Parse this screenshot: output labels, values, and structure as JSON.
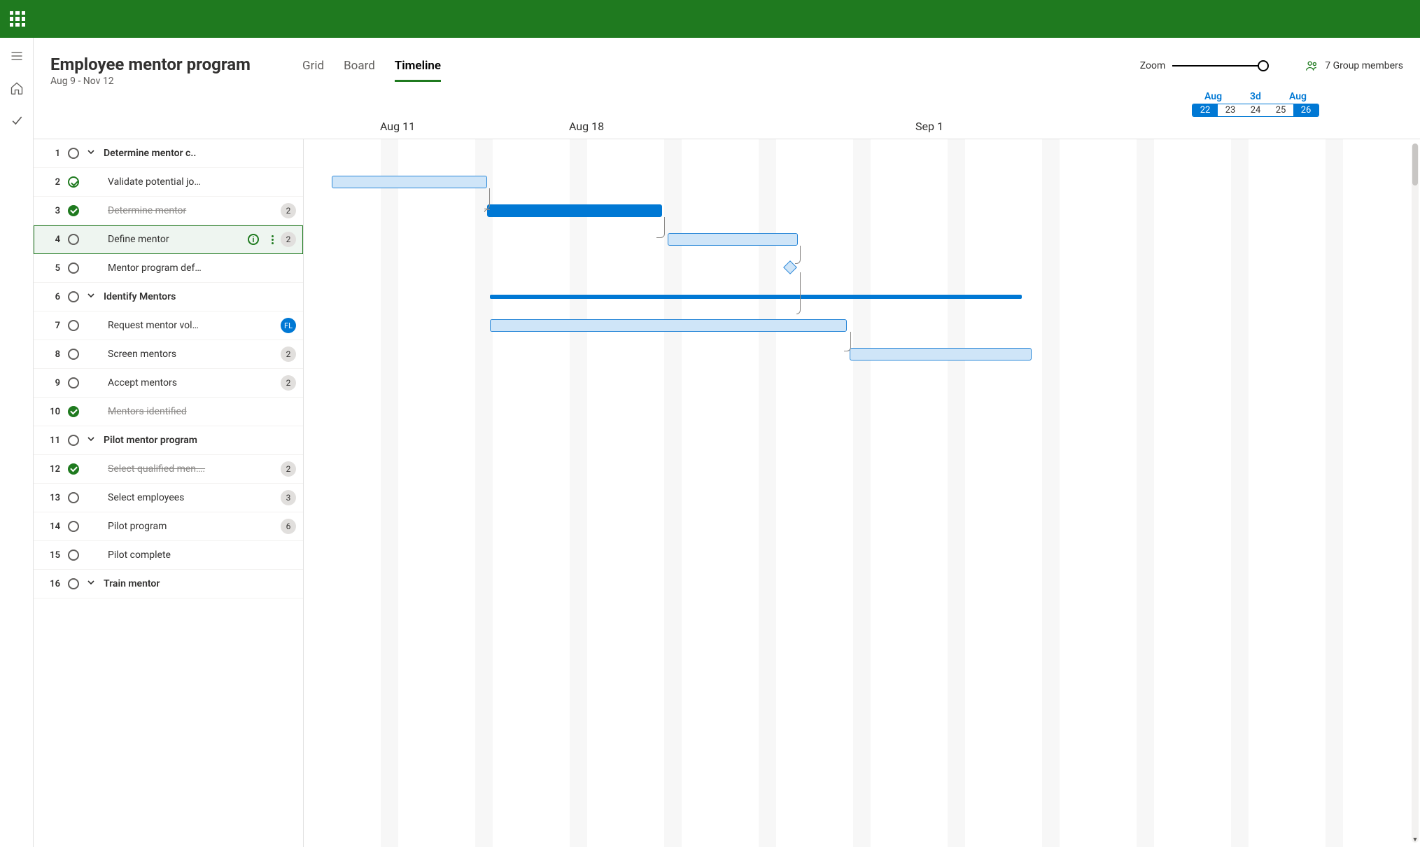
{
  "header": {
    "title": "Employee mentor program",
    "subtitle": "Aug 9 - Nov 12"
  },
  "tabs": {
    "grid": "Grid",
    "board": "Board",
    "timeline": "Timeline"
  },
  "zoom_label": "Zoom",
  "members_label": "7 Group members",
  "date_overview": {
    "labels": [
      "Aug",
      "3d",
      "Aug"
    ],
    "days": [
      "22",
      "23",
      "24",
      "25",
      "26"
    ]
  },
  "timeline_headers": [
    "Aug 11",
    "Aug 18",
    "Sep  1"
  ],
  "tasks": [
    {
      "num": "1",
      "name": "Determine mentor c..",
      "status": "open",
      "summary": true
    },
    {
      "num": "2",
      "name": "Validate potential jo…",
      "status": "doneopen",
      "indent": true
    },
    {
      "num": "3",
      "name": "Determine mentor",
      "status": "donefill",
      "indent": true,
      "struck": true,
      "badge": "2"
    },
    {
      "num": "4",
      "name": "Define mentor",
      "status": "open",
      "indent": true,
      "badge": "2",
      "selected": true,
      "info": true
    },
    {
      "num": "5",
      "name": "Mentor program def…",
      "status": "open",
      "indent": true
    },
    {
      "num": "6",
      "name": "Identify Mentors",
      "status": "open",
      "summary": true
    },
    {
      "num": "7",
      "name": "Request mentor vol…",
      "status": "open",
      "indent": true,
      "avatar": "FL"
    },
    {
      "num": "8",
      "name": "Screen mentors",
      "status": "open",
      "indent": true,
      "badge": "2"
    },
    {
      "num": "9",
      "name": "Accept mentors",
      "status": "open",
      "indent": true,
      "badge": "2"
    },
    {
      "num": "10",
      "name": "Mentors identified",
      "status": "donefill",
      "indent": true,
      "struck": true
    },
    {
      "num": "11",
      "name": "Pilot mentor  program",
      "status": "open",
      "summary": true
    },
    {
      "num": "12",
      "name": "Select qualified men….",
      "status": "donefill",
      "indent": true,
      "struck": true,
      "badge": "2"
    },
    {
      "num": "13",
      "name": "Select employees",
      "status": "open",
      "indent": true,
      "badge": "3"
    },
    {
      "num": "14",
      "name": "Pilot program",
      "status": "open",
      "indent": true,
      "badge": "6"
    },
    {
      "num": "15",
      "name": "Pilot complete",
      "status": "open",
      "indent": true
    },
    {
      "num": "16",
      "name": "Train mentor",
      "status": "open",
      "summary": true
    }
  ]
}
